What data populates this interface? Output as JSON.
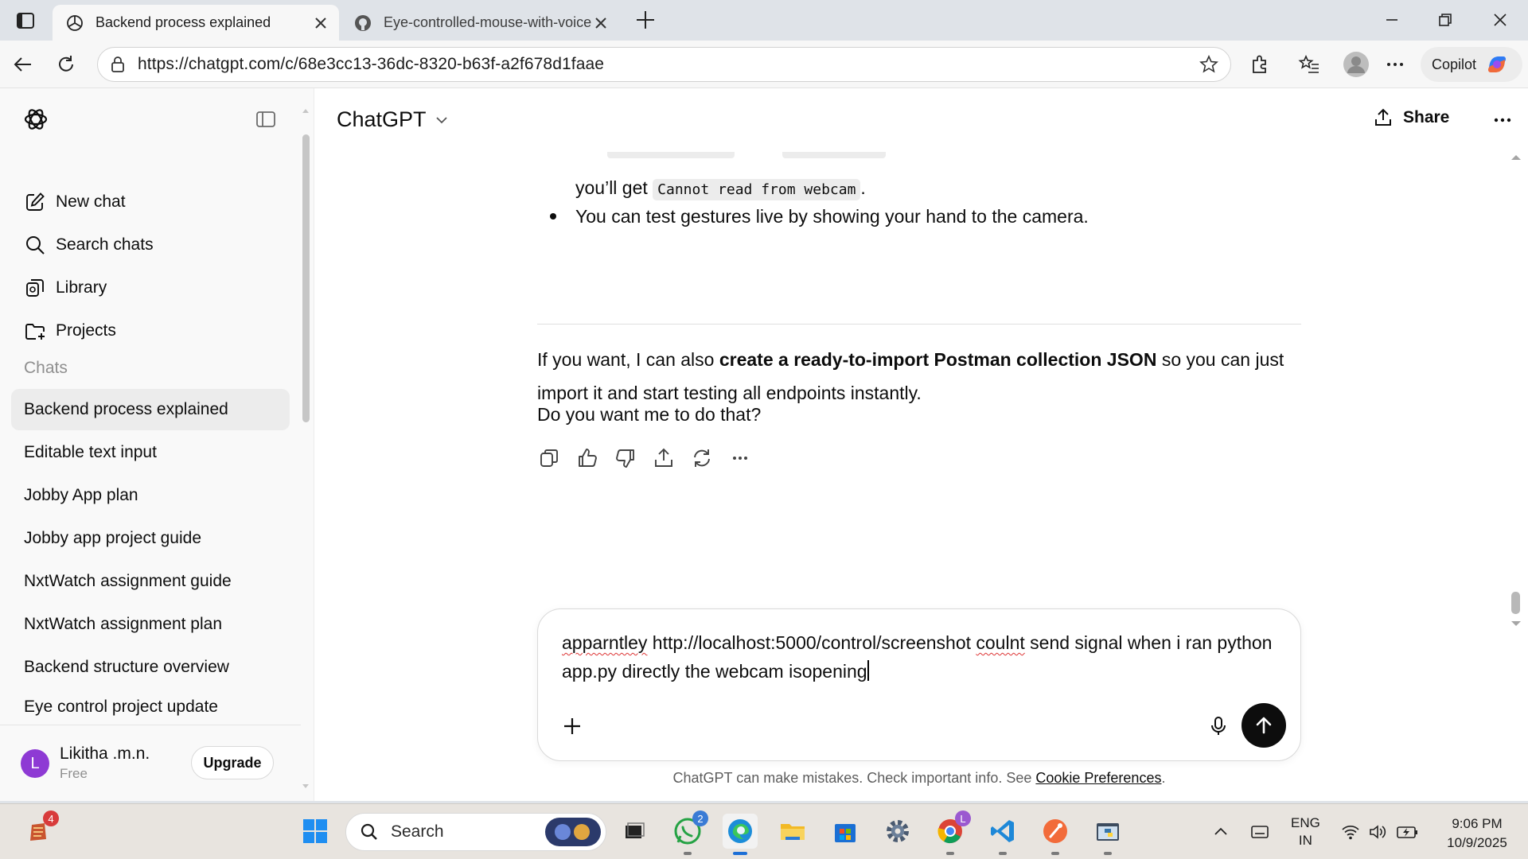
{
  "browser": {
    "tabs": [
      {
        "title": "Backend process explained",
        "active": true
      },
      {
        "title": "Eye-controlled-mouse-with-voice",
        "active": false
      }
    ],
    "url": "https://chatgpt.com/c/68e3cc13-36dc-8320-b63f-a2f678d1faae",
    "copilot_label": "Copilot"
  },
  "sidebar": {
    "nav": [
      {
        "label": "New chat",
        "icon": "edit-icon"
      },
      {
        "label": "Search chats",
        "icon": "search-icon"
      },
      {
        "label": "Library",
        "icon": "library-icon"
      },
      {
        "label": "Projects",
        "icon": "folder-icon"
      }
    ],
    "chats_heading": "Chats",
    "chats": [
      "Backend process explained",
      "Editable text input",
      "Jobby App plan",
      "Jobby app project guide",
      "NxtWatch assignment guide",
      "NxtWatch assignment plan",
      "Backend structure overview",
      "Eye control project update"
    ],
    "user": {
      "initial": "L",
      "name": "Likitha .m.n.",
      "plan": "Free",
      "upgrade_label": "Upgrade"
    }
  },
  "header": {
    "model": "ChatGPT",
    "share_label": "Share"
  },
  "message": {
    "bullet1_prefix": "you’ll get",
    "bullet1_code": "Cannot read from webcam",
    "bullet1_suffix": ".",
    "bullet2": "You can test gestures live by showing your hand to the camera.",
    "p1_before": "If you want, I can also ",
    "p1_bold": "create a ready-to-import Postman collection JSON",
    "p1_after": " so you can just import it and start testing all endpoints instantly.",
    "p2": "Do you want me to do that?"
  },
  "composer": {
    "w1": "apparntley",
    "t1": " http://localhost:5000/control/screenshot ",
    "w2": "coulnt",
    "t2": " send signal when i ran python app.py directly the webcam isopening"
  },
  "disclaimer": {
    "text": "ChatGPT can make mistakes. Check important info. See ",
    "link": "Cookie Preferences",
    "end": "."
  },
  "taskbar": {
    "search_placeholder": "Search",
    "badge_left": "4",
    "whatsapp_badge": "2",
    "chrome_badge": "L",
    "lang_top": "ENG",
    "lang_bottom": "IN",
    "time": "9:06 PM",
    "date": "10/9/2025"
  },
  "colors": {
    "accent": "#0d0d0d",
    "avatar": "#8e3ad4",
    "badge": "#3a7bd5"
  }
}
